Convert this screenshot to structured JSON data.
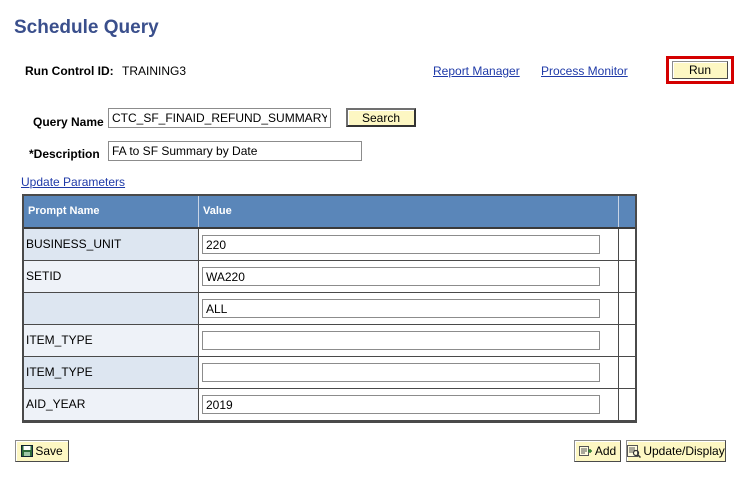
{
  "page": {
    "title": "Schedule Query"
  },
  "run_control": {
    "label": "Run Control ID:",
    "value": "TRAINING3"
  },
  "links": {
    "report_manager": "Report Manager",
    "process_monitor": "Process Monitor",
    "update_parameters": "Update Parameters"
  },
  "buttons": {
    "run": "Run",
    "search": "Search",
    "save": "Save",
    "add": "Add",
    "update_display": "Update/Display"
  },
  "form": {
    "query_name_label": "Query Name",
    "query_name_value": "CTC_SF_FINAID_REFUND_SUMMARY",
    "description_label": "*Description",
    "description_value": "FA to SF Summary by Date"
  },
  "grid": {
    "headers": [
      "Prompt Name",
      "Value"
    ],
    "rows": [
      {
        "prompt": "BUSINESS_UNIT",
        "value": "220"
      },
      {
        "prompt": "SETID",
        "value": "WA220"
      },
      {
        "prompt": "",
        "value": "ALL"
      },
      {
        "prompt": "ITEM_TYPE",
        "value": ""
      },
      {
        "prompt": "ITEM_TYPE",
        "value": ""
      },
      {
        "prompt": "AID_YEAR",
        "value": "2019"
      }
    ]
  },
  "icons": {
    "save": "save-disk-icon",
    "add": "add-icon",
    "update_display": "update-display-icon"
  },
  "colors": {
    "title": "#3a4f8c",
    "link": "#1f3aa8",
    "grid_header": "#5a86b9",
    "button_bg": "#fdf7c3",
    "run_highlight": "#d40000"
  }
}
